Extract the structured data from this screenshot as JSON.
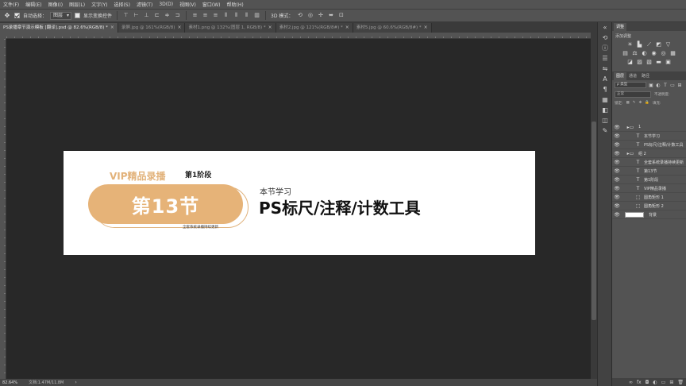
{
  "menu": [
    "文件(F)",
    "编辑(E)",
    "图像(I)",
    "图层(L)",
    "文字(Y)",
    "选择(S)",
    "滤镜(T)",
    "3D(D)",
    "视图(V)",
    "窗口(W)",
    "帮助(H)"
  ],
  "options": {
    "auto_select_label": "自动选择：",
    "auto_select_target": "图层",
    "show_transform_label": "显示变换控件",
    "mode_3d_label": "3D 模式："
  },
  "tabs": [
    {
      "label": "PS录播章节演示模板 [翻译].psd @ 82.6%(RGB/8) *",
      "active": true
    },
    {
      "label": "录屏.jpg @ 161%(RGB/8)",
      "active": false
    },
    {
      "label": "素材1.png @ 132%(图层 1, RGB/8) *",
      "active": false
    },
    {
      "label": "素材2.jpg @ 121%(RGB/8#) *",
      "active": false
    },
    {
      "label": "素材5.jpg @ 60.6%(RGB/8#) *",
      "active": false
    }
  ],
  "document": {
    "vip_title": "VIP精品录播",
    "stage": "第1阶段",
    "chapter": "第13节",
    "subtitle": "全套系统录播持续更新",
    "lesson_label": "本节学习",
    "lesson_title": "PS标尺/注释/计数工具",
    "accent_color": "#e6b378"
  },
  "status": {
    "zoom": "82.64%",
    "doc_info": "文档:1.47M/11.8M"
  },
  "panels": {
    "top_tab": "调整",
    "add_adjustment": "添加调整",
    "layer_tabs": [
      "图层",
      "通道",
      "路径"
    ],
    "kind_filter": "ρ 类型",
    "blend_mode": "正常",
    "opacity_label": "不透明度:",
    "lock_label": "锁定:",
    "fill_label": "填充:",
    "layers": [
      {
        "type": "group",
        "indent": 0,
        "name": "1"
      },
      {
        "type": "text",
        "indent": 1,
        "name": "本节学习"
      },
      {
        "type": "text",
        "indent": 1,
        "name": "PS标尺/注释/计数工具"
      },
      {
        "type": "group",
        "indent": 0,
        "name": "组 2"
      },
      {
        "type": "text",
        "indent": 1,
        "name": "全套系统录播持续更新"
      },
      {
        "type": "text",
        "indent": 1,
        "name": "第13节"
      },
      {
        "type": "text",
        "indent": 1,
        "name": "第1阶段"
      },
      {
        "type": "text",
        "indent": 1,
        "name": "VIP精品录播"
      },
      {
        "type": "shape",
        "indent": 1,
        "name": "圆角矩形 1"
      },
      {
        "type": "shape",
        "indent": 1,
        "name": "圆角矩形 2"
      },
      {
        "type": "pixel",
        "indent": 0,
        "name": "背景"
      }
    ]
  }
}
